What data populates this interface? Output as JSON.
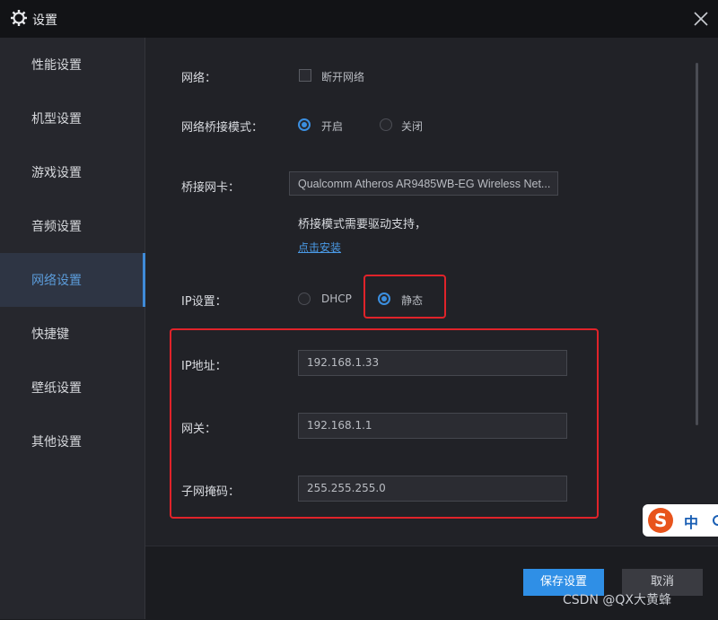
{
  "window": {
    "title": "设置"
  },
  "sidebar": {
    "items": [
      {
        "label": "性能设置"
      },
      {
        "label": "机型设置"
      },
      {
        "label": "游戏设置"
      },
      {
        "label": "音频设置"
      },
      {
        "label": "网络设置",
        "active": true
      },
      {
        "label": "快捷键"
      },
      {
        "label": "壁纸设置"
      },
      {
        "label": "其他设置"
      }
    ]
  },
  "network": {
    "label": "网络：",
    "disconnect_label": "断开网络",
    "disconnect_checked": false
  },
  "bridge_mode": {
    "label": "网络桥接模式：",
    "options": [
      {
        "label": "开启",
        "selected": true
      },
      {
        "label": "关闭",
        "selected": false
      }
    ]
  },
  "bridge_card": {
    "label": "桥接网卡：",
    "value": "Qualcomm Atheros AR9485WB-EG Wireless Net..."
  },
  "driver_note": {
    "text": "桥接模式需要驱动支持，",
    "link": "点击安装"
  },
  "ip_setting": {
    "label": "IP设置：",
    "options": [
      {
        "label": "DHCP",
        "selected": false
      },
      {
        "label": "静态",
        "selected": true
      }
    ]
  },
  "ip_address": {
    "label": "IP地址：",
    "value": "192.168.1.33"
  },
  "gateway": {
    "label": "网关：",
    "value": "192.168.1.1"
  },
  "subnet_mask": {
    "label": "子网掩码：",
    "value": "255.255.255.0"
  },
  "footer": {
    "save_label": "保存设置",
    "cancel_label": "取消"
  },
  "watermark": "CSDN @QX大黄蜂",
  "ime": {
    "logo": "S",
    "mode": "中"
  },
  "colors": {
    "accent": "#2f8fe6",
    "highlight": "#e0232a",
    "sidebar_active_text": "#5b9bd9"
  }
}
